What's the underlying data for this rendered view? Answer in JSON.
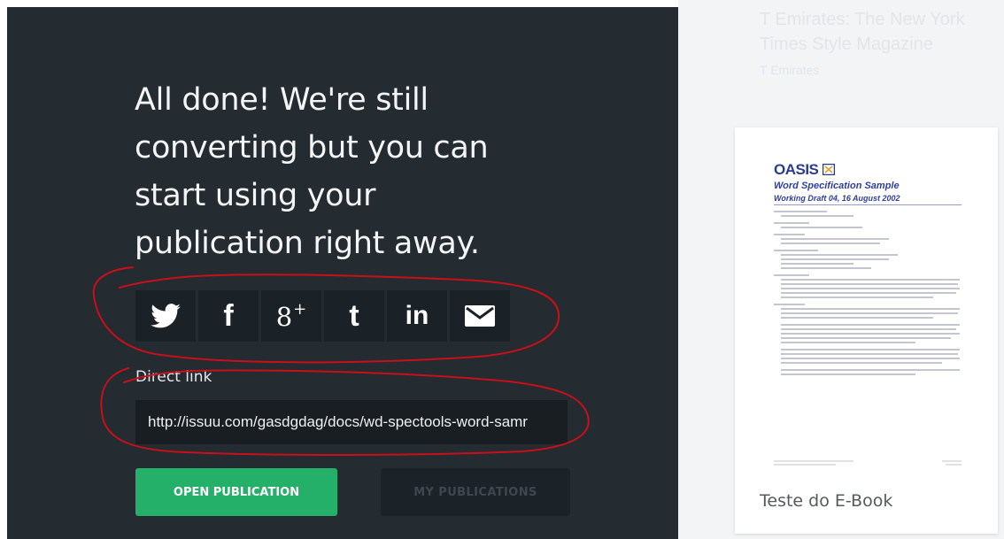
{
  "headline": "All done! We're still converting but you can start using your publication right away.",
  "share": {
    "buttons": [
      {
        "network": "twitter",
        "icon": "twitter-icon"
      },
      {
        "network": "facebook",
        "icon": "facebook-icon",
        "glyph": "f"
      },
      {
        "network": "google-plus",
        "icon": "google-plus-icon",
        "glyph": "8",
        "sup": "+"
      },
      {
        "network": "tumblr",
        "icon": "tumblr-icon",
        "glyph": "t"
      },
      {
        "network": "linkedin",
        "icon": "linkedin-icon",
        "glyph": "in"
      },
      {
        "network": "email",
        "icon": "envelope-icon"
      }
    ]
  },
  "direct_link": {
    "label": "Direct link",
    "value": "http://issuu.com/gasdgdag/docs/wd-spectools-word-samr"
  },
  "actions": {
    "open_label": "OPEN PUBLICATION",
    "mypubs_label": "MY PUBLICATIONS"
  },
  "background_card": {
    "title": "T Emirates: The New York Times Style Magazine",
    "subtitle": "T Emirates"
  },
  "publication": {
    "title": "Teste do E-Book",
    "thumbnail": {
      "logo": "OASIS",
      "heading": "Word Specification Sample",
      "subheading": "Working Draft 04, 16 August 2002"
    }
  },
  "colors": {
    "panel_bg": "#242b31",
    "share_btn_bg": "#1b2227",
    "primary_green": "#25b069",
    "annotation_red": "#c8101a",
    "oasis_blue": "#2b3c8f"
  }
}
